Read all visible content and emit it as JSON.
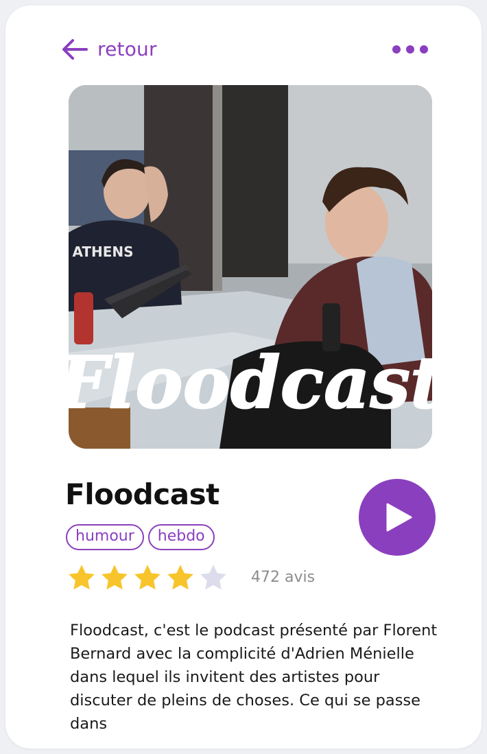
{
  "header": {
    "back_label": "retour"
  },
  "cover": {
    "logo_text": "Floodcast",
    "shirt_text": "ATHENS"
  },
  "podcast": {
    "title": "Floodcast",
    "tags": [
      "humour",
      "hebdo"
    ],
    "rating": 4,
    "rating_max": 5,
    "reviews_label": "472 avis",
    "description": "Floodcast, c'est le podcast présenté par Florent Bernard avec la complicité d'Adrien Ménielle dans lequel ils invitent des artistes pour discuter de pleins de choses. Ce qui se passe dans"
  },
  "colors": {
    "accent": "#8a3fbf",
    "star_filled": "#f7c52b",
    "star_empty": "#dcdcec"
  }
}
